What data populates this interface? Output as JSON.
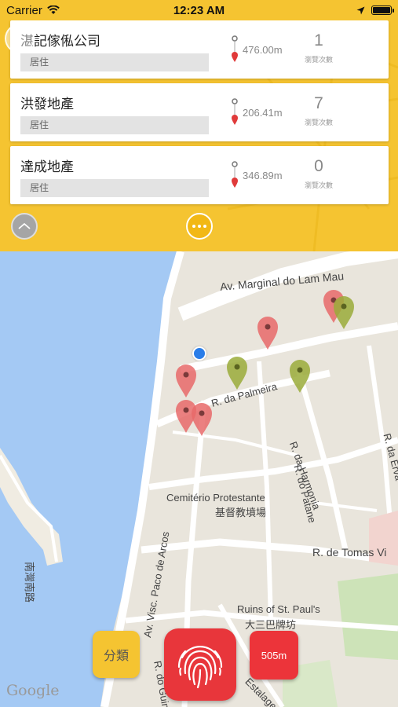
{
  "status_bar": {
    "carrier": "Carrier",
    "time": "12:23 AM",
    "battery_level": 1.0,
    "icons": [
      "wifi-icon",
      "location-arrow-icon",
      "battery-icon"
    ]
  },
  "listings": [
    {
      "name": "湛記傢俬公司",
      "category": "居住",
      "distance": "476.00m",
      "count": "1",
      "count_label": "瀏覽次數"
    },
    {
      "name": "洪發地產",
      "category": "居住",
      "distance": "206.41m",
      "count": "7",
      "count_label": "瀏覽次數"
    },
    {
      "name": "達成地產",
      "category": "居住",
      "distance": "346.89m",
      "count": "0",
      "count_label": "瀏覽次數"
    }
  ],
  "map": {
    "labels": {
      "lam_mau": "Av. Marginal do Lam Mau",
      "palmeira": "R. da Palmeira",
      "harmonia": "R. da Harmonia",
      "patane": "R. do Patane",
      "erva": "R. da Erva",
      "cemiterio": "Cemitério Protestante",
      "cemiterio_zh": "基督教墳場",
      "tomas": "R. de Tomas Vi",
      "paco": "Av. Visc. Paco de Arcos",
      "guimaraes": "R. do Guimarães",
      "ruins": "Ruins of St. Paul's",
      "ruins_zh": "大三巴牌坊",
      "estalagens": "Estalagens",
      "south_road": "南灣南路"
    },
    "logo": "Google"
  },
  "controls": {
    "category_label": "分類",
    "radius_label": "505m"
  },
  "colors": {
    "accent_yellow": "#f5c431",
    "pin_red": "#e86a6a",
    "pin_green": "#9aab3a",
    "action_red": "#e8363b",
    "water": "#a4c9f4"
  }
}
